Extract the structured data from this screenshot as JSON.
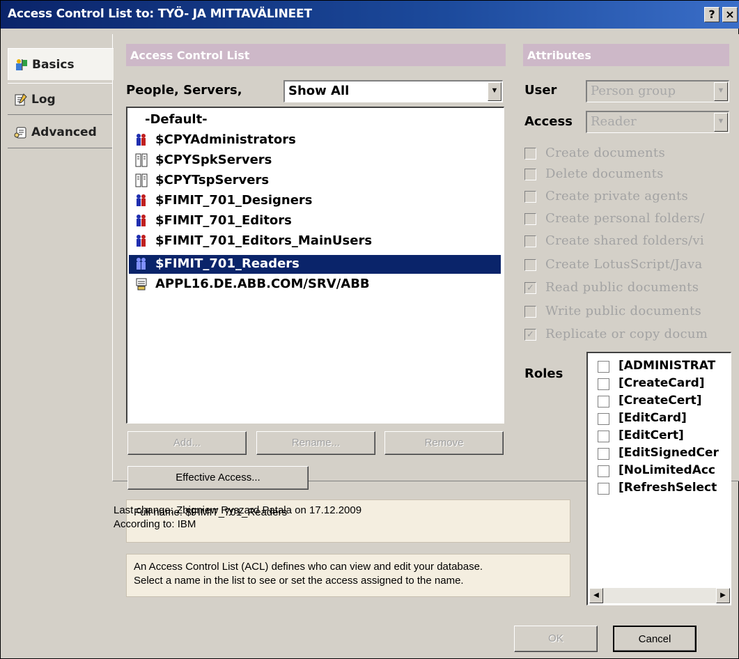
{
  "window": {
    "title": "Access Control List to: TYÖ- JA MITTAVÄLINEET",
    "help_label": "?",
    "close_label": "×"
  },
  "tabs": [
    {
      "label": "Basics",
      "icon": "person-flag-icon"
    },
    {
      "label": "Log",
      "icon": "log-book-icon"
    },
    {
      "label": "Advanced",
      "icon": "scroll-key-icon"
    }
  ],
  "acl": {
    "section_title": "Access Control List",
    "filter_label": "People, Servers,",
    "filter_value": "Show All",
    "entries": [
      {
        "name": "-Default-",
        "icon": "none"
      },
      {
        "name": "$CPYAdministrators",
        "icon": "person-group-icon"
      },
      {
        "name": "$CPYSpkServers",
        "icon": "server-group-icon"
      },
      {
        "name": "$CPYTspServers",
        "icon": "server-group-icon"
      },
      {
        "name": "$FIMIT_701_Designers",
        "icon": "person-group-icon"
      },
      {
        "name": "$FIMIT_701_Editors",
        "icon": "person-group-icon"
      },
      {
        "name": "$FIMIT_701_Editors_MainUsers",
        "icon": "person-group-icon"
      },
      {
        "name": "$FIMIT_701_Readers",
        "icon": "person-group-icon",
        "selected": true
      },
      {
        "name": "APPL16.DE.ABB.COM/SRV/ABB",
        "icon": "server-icon"
      }
    ],
    "add_label": "Add...",
    "rename_label": "Rename...",
    "remove_label": "Remove",
    "effective_access_label": "Effective Access...",
    "full_name_text": "Full name: $FIMIT_701_Readers",
    "help_text_1": "An Access Control List (ACL) defines who can view and edit your database.",
    "help_text_2": "Select a name in the list to see or set the access assigned to the name."
  },
  "attributes": {
    "section_title": "Attributes",
    "user_label": "User",
    "user_value": "Person group",
    "access_label": "Access",
    "access_value": "Reader",
    "permissions": [
      {
        "label": "Create documents",
        "checked": false
      },
      {
        "label": "Delete documents",
        "checked": false
      },
      {
        "label": "Create private agents",
        "checked": false
      },
      {
        "label": "Create personal folders/",
        "checked": false
      },
      {
        "label": "Create shared folders/vi",
        "checked": false
      },
      {
        "label": "Create LotusScript/Java",
        "checked": false
      },
      {
        "label": "Read public documents",
        "checked": true
      },
      {
        "label": "Write public documents",
        "checked": false
      },
      {
        "label": "Replicate or copy docum",
        "checked": true
      }
    ],
    "roles_label": "Roles",
    "roles": [
      "[ADMINISTRAT",
      "[CreateCard]",
      "[CreateCert]",
      "[EditCard]",
      "[EditCert]",
      "[EditSignedCer",
      "[NoLimitedAcc",
      "[RefreshSelect"
    ]
  },
  "footer": {
    "last_change": "Last change: Zbigniew Ryszard Patala on 17.12.2009",
    "according_to": "According to: IBM",
    "ok_label": "OK",
    "cancel_label": "Cancel"
  }
}
